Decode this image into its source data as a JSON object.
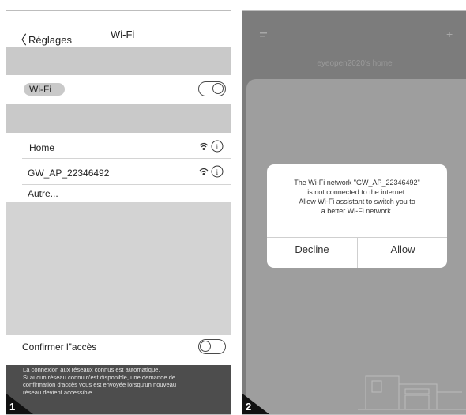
{
  "panel1": {
    "nav": {
      "back_label": "Réglages",
      "title": "Wi-Fi"
    },
    "wifi_label": "Wi-Fi",
    "networks": [
      {
        "name": "Home"
      },
      {
        "name": "GW_AP_22346492"
      },
      {
        "name": "Autre..."
      }
    ],
    "confirm_label": "Confirmer l\"accès",
    "footer_lines": [
      "La connexion aux réseaux connus est automatique.",
      "Si aucun réseau connu n'est disponible, une demande de",
      "confirmation d'accès vous est envoyée lorsqu'un nouveau",
      "réseau devient accessible."
    ],
    "step_number": "1"
  },
  "panel2": {
    "home_title": "eyeopen2020's home",
    "alert": {
      "lines": [
        "The Wi-Fi network \"GW_AP_22346492\"",
        "is not connected to the internet.",
        "Allow Wi-Fi assistant to switch you to",
        "a better Wi-Fi network."
      ],
      "decline_label": "Decline",
      "allow_label": "Allow"
    },
    "step_number": "2"
  }
}
